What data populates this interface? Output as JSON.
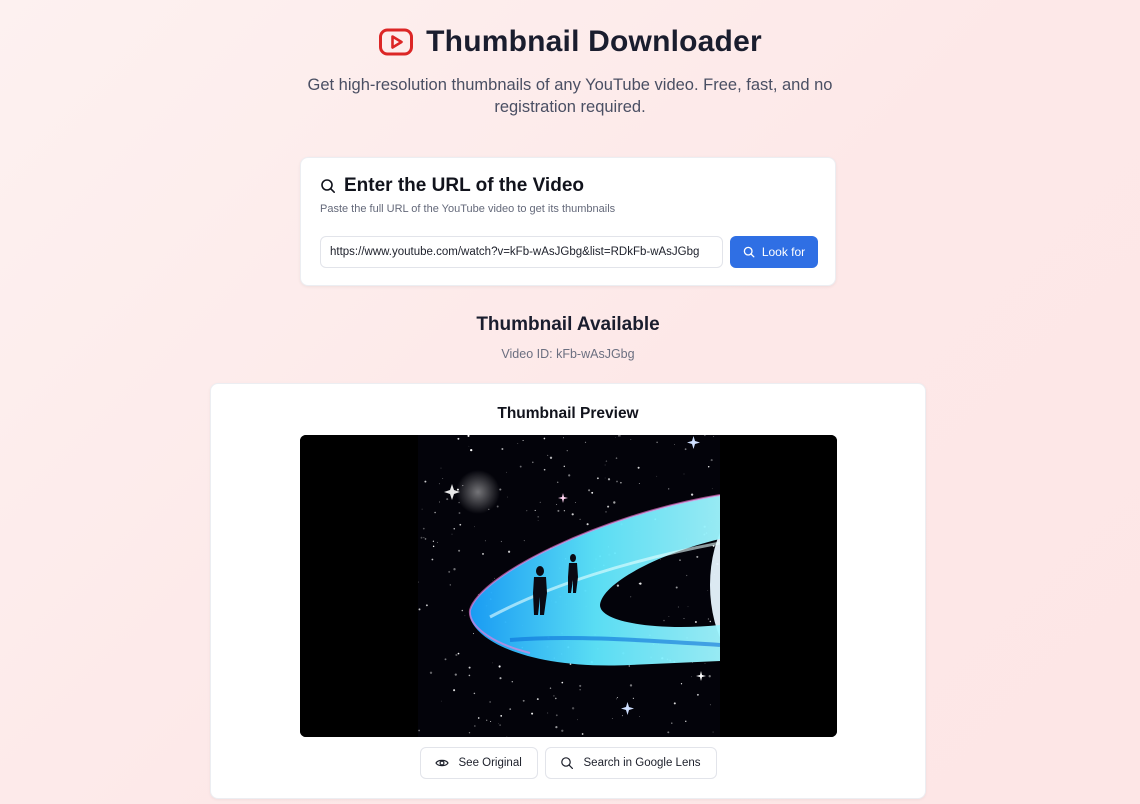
{
  "header": {
    "title": "Thumbnail Downloader",
    "subtitle": "Get high-resolution thumbnails of any YouTube video. Free, fast, and no registration required.",
    "logo_icon": "youtube-play-icon",
    "brand_color": "#dc2626"
  },
  "search": {
    "title": "Enter the URL of the Video",
    "description": "Paste the full URL of the YouTube video to get its thumbnails",
    "input_value": "https://www.youtube.com/watch?v=kFb-wAsJGbg&list=RDkFb-wAsJGbg",
    "button_label": "Look for",
    "title_icon": "search-icon",
    "accent_color": "#2f6fe4"
  },
  "result": {
    "title": "Thumbnail Available",
    "video_id_label": "Video ID: kFb-wAsJGbg"
  },
  "preview": {
    "title": "Thumbnail Preview",
    "image_description_icon": "thumbnail-image",
    "see_original_label": "See Original",
    "google_lens_label": "Search in Google Lens",
    "see_original_icon": "eye-icon",
    "google_lens_icon": "search-icon"
  }
}
